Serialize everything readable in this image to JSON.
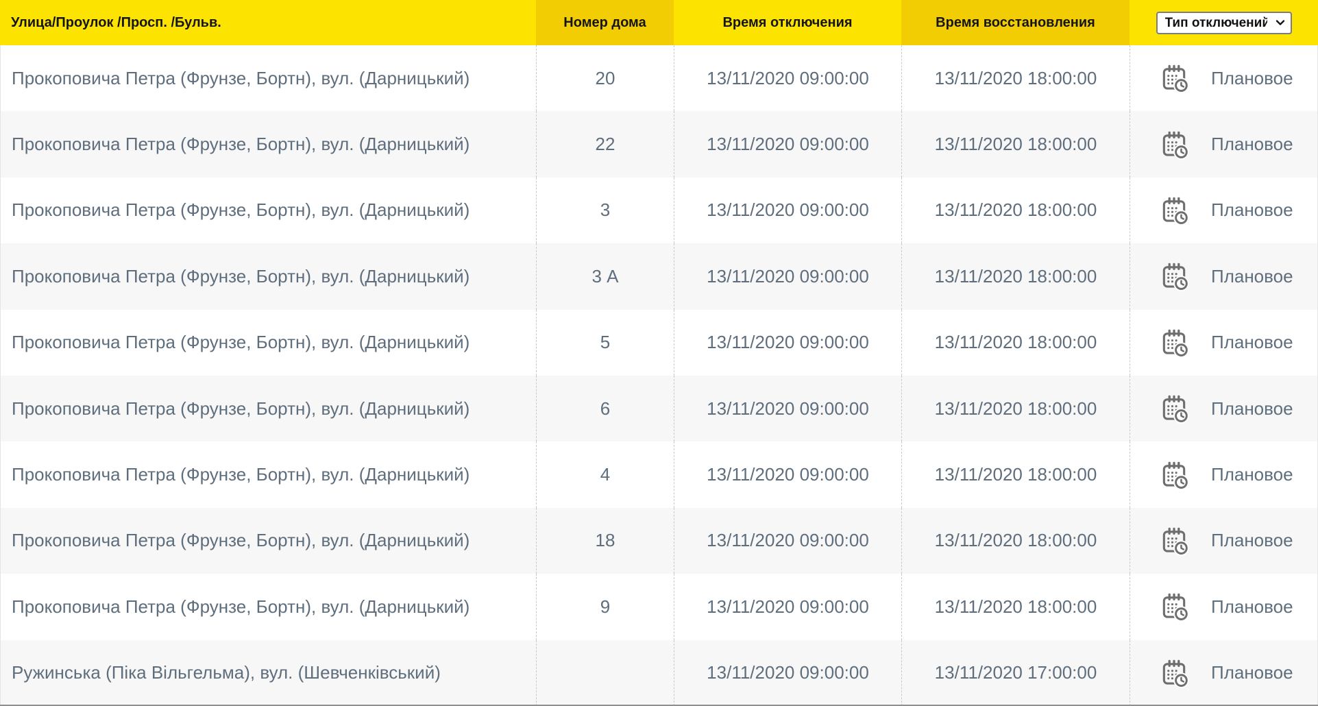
{
  "colors": {
    "header_yellow_bright": "#fde300",
    "header_yellow_dark": "#f3cd04",
    "row_stripe": "#f7f7f8",
    "body_text": "#5f6e7d",
    "header_text": "#151515",
    "icon_gray": "#6e6e6e"
  },
  "table": {
    "columns": {
      "street": "Улица/Проулок /Просп. /Бульв.",
      "house": "Номер дома",
      "outage": "Время отключения",
      "restore": "Время восстановления"
    },
    "type_filter": {
      "selected": "Тип отключений"
    },
    "rows": [
      {
        "street": "Прокоповича Петра (Фрунзе, Бортн), вул. (Дарницький)",
        "house": "20",
        "outage_time": "13/11/2020 09:00:00",
        "restore_time": "13/11/2020 18:00:00",
        "type": "Плановое"
      },
      {
        "street": "Прокоповича Петра (Фрунзе, Бортн), вул. (Дарницький)",
        "house": "22",
        "outage_time": "13/11/2020 09:00:00",
        "restore_time": "13/11/2020 18:00:00",
        "type": "Плановое"
      },
      {
        "street": "Прокоповича Петра (Фрунзе, Бортн), вул. (Дарницький)",
        "house": "3",
        "outage_time": "13/11/2020 09:00:00",
        "restore_time": "13/11/2020 18:00:00",
        "type": "Плановое"
      },
      {
        "street": "Прокоповича Петра (Фрунзе, Бортн), вул. (Дарницький)",
        "house": "3 А",
        "outage_time": "13/11/2020 09:00:00",
        "restore_time": "13/11/2020 18:00:00",
        "type": "Плановое"
      },
      {
        "street": "Прокоповича Петра (Фрунзе, Бортн), вул. (Дарницький)",
        "house": "5",
        "outage_time": "13/11/2020 09:00:00",
        "restore_time": "13/11/2020 18:00:00",
        "type": "Плановое"
      },
      {
        "street": "Прокоповича Петра (Фрунзе, Бортн), вул. (Дарницький)",
        "house": "6",
        "outage_time": "13/11/2020 09:00:00",
        "restore_time": "13/11/2020 18:00:00",
        "type": "Плановое"
      },
      {
        "street": "Прокоповича Петра (Фрунзе, Бортн), вул. (Дарницький)",
        "house": "4",
        "outage_time": "13/11/2020 09:00:00",
        "restore_time": "13/11/2020 18:00:00",
        "type": "Плановое"
      },
      {
        "street": "Прокоповича Петра (Фрунзе, Бортн), вул. (Дарницький)",
        "house": "18",
        "outage_time": "13/11/2020 09:00:00",
        "restore_time": "13/11/2020 18:00:00",
        "type": "Плановое"
      },
      {
        "street": "Прокоповича Петра (Фрунзе, Бортн), вул. (Дарницький)",
        "house": "9",
        "outage_time": "13/11/2020 09:00:00",
        "restore_time": "13/11/2020 18:00:00",
        "type": "Плановое"
      },
      {
        "street": "Ружинська (Піка Вільгельма), вул. (Шевченківський)",
        "house": "",
        "outage_time": "13/11/2020 09:00:00",
        "restore_time": "13/11/2020 17:00:00",
        "type": "Плановое"
      }
    ]
  }
}
